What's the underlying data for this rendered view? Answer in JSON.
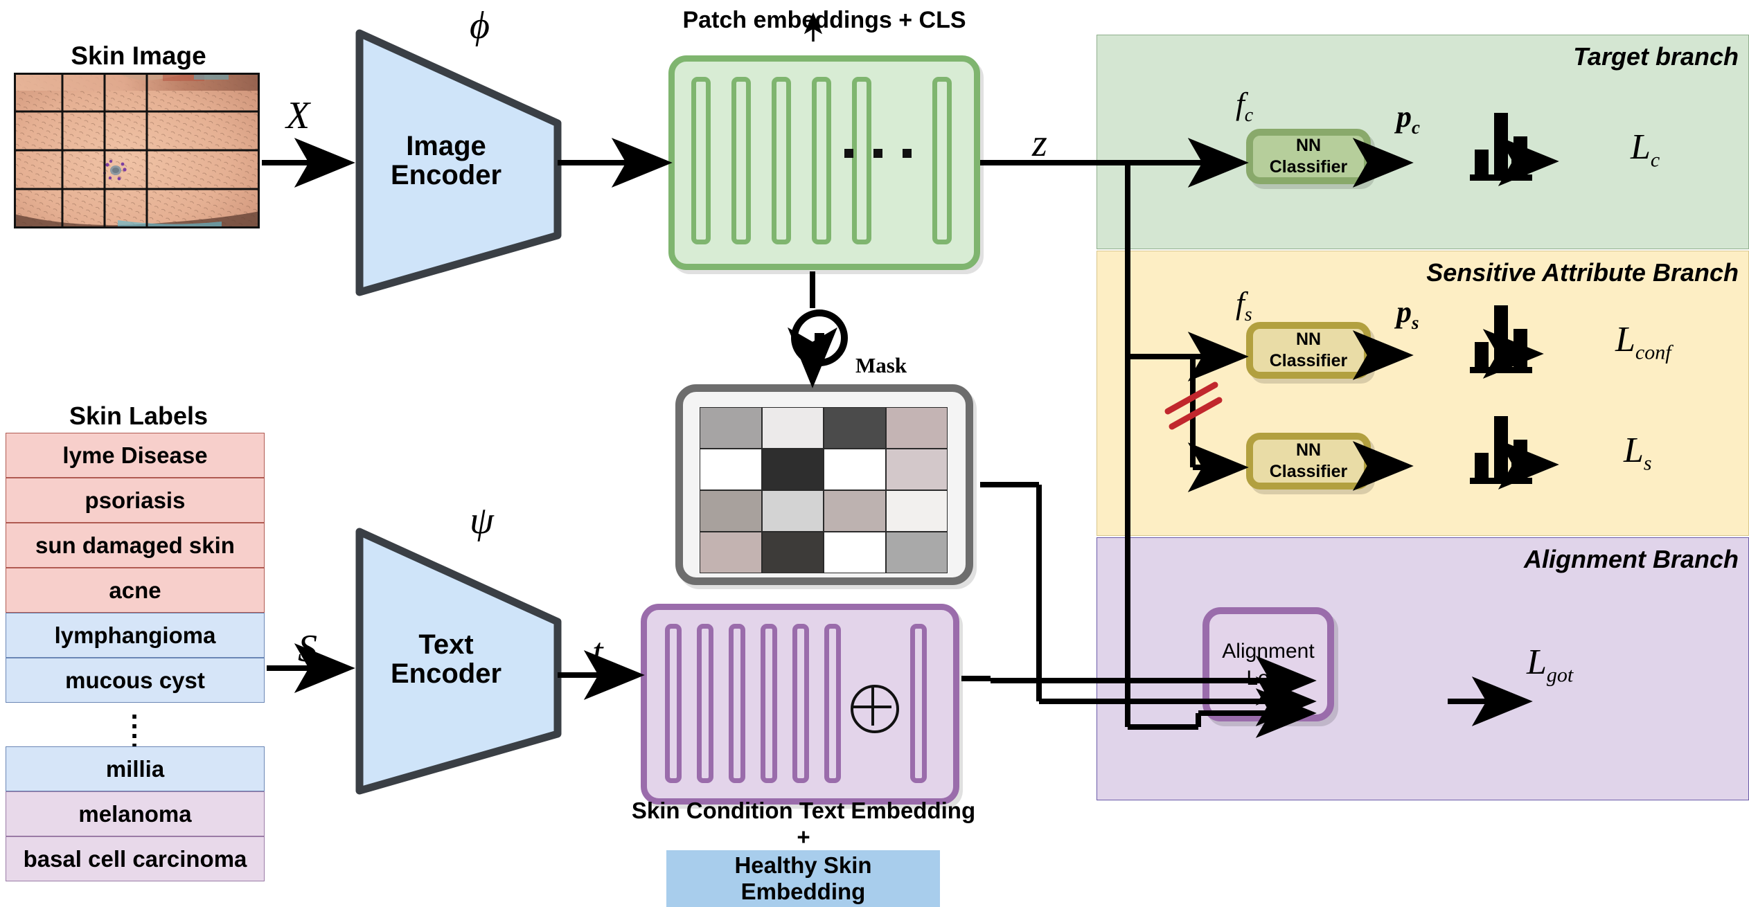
{
  "image_panel": {
    "title": "Skin Image",
    "grid": "4x4",
    "input_symbol": "X"
  },
  "labels_panel": {
    "title": "Skin Labels",
    "items": [
      {
        "text": "lyme Disease",
        "group": "pink"
      },
      {
        "text": "psoriasis",
        "group": "pink"
      },
      {
        "text": "sun damaged skin",
        "group": "pink"
      },
      {
        "text": "acne",
        "group": "pink"
      },
      {
        "text": "lymphangioma",
        "group": "blue"
      },
      {
        "text": "mucous cyst",
        "group": "blue"
      },
      {
        "text": "millia",
        "group": "blue"
      },
      {
        "text": "melanoma",
        "group": "purple"
      },
      {
        "text": "basal cell carcinoma",
        "group": "purple"
      }
    ],
    "ellipsis": "vertical-dots",
    "input_symbol": "S"
  },
  "encoders": {
    "image": {
      "line1": "Image",
      "line2": "Encoder",
      "param": "ϕ",
      "input": "X"
    },
    "text": {
      "line1": "Text",
      "line2": "Encoder",
      "param": "ψ",
      "input": "S",
      "output": "t"
    }
  },
  "patch_embeddings": {
    "title": "Patch embeddings + CLS",
    "bar_count": 6,
    "ellipsis": "...",
    "output_symbol": "z"
  },
  "mask": {
    "title": "Mask",
    "operator": "⊙",
    "rows": 4,
    "cols": 4,
    "cells": [
      [
        "#a6a4a4",
        "#eceaea",
        "#4b4b4b",
        "#c4b4b4"
      ],
      [
        "#ffffff",
        "#2e2e2e",
        "#ffffff",
        "#d3c8ca"
      ],
      [
        "#a8a19d",
        "#d3d3d3",
        "#bdb2b0",
        "#f2f0ee"
      ],
      [
        "#c3b3b1",
        "#3d3b39",
        "#ffffff",
        "#a9a9a9"
      ]
    ]
  },
  "text_embedding": {
    "bar_count": 7,
    "operator": "⊕",
    "caption_line1": "Skin Condition Text Embedding",
    "caption_plus": "+",
    "caption_line2": "Healthy Skin Embedding",
    "highlight_color": "#a8cdec"
  },
  "branches": [
    {
      "id": "target",
      "title": "Target branch",
      "bg": "#d4e6d2",
      "fn_symbol": "f_c",
      "classifier": {
        "line1": "NN",
        "line2": "Classifier",
        "fill": "#b6ce9b",
        "stroke": "#89a96b"
      },
      "prob_symbol": "p_c",
      "histogram": [
        0.4,
        1.0,
        0.62
      ],
      "loss_symbol": "L_c"
    },
    {
      "id": "sensitive",
      "title": "Sensitive Attribute Branch",
      "bg": "#fdeec4",
      "fn_symbol": "f_s",
      "gradient_block": "red-double-slash",
      "rows": [
        {
          "classifier": {
            "line1": "NN",
            "line2": "Classifier",
            "fill": "#e9dca6",
            "stroke": "#b2a03f"
          },
          "prob_symbol": "p_s",
          "histogram": [
            0.4,
            1.0,
            0.62
          ],
          "loss_symbol": "L_conf"
        },
        {
          "classifier": {
            "line1": "NN",
            "line2": "Classifier",
            "fill": "#e9dca6",
            "stroke": "#b2a03f"
          },
          "prob_symbol": "",
          "histogram": [
            0.4,
            1.0,
            0.62
          ],
          "loss_symbol": "L_s"
        }
      ]
    },
    {
      "id": "alignment",
      "title": "Alignment Branch",
      "bg": "#e0d4ea",
      "box": {
        "line1": "Alignment",
        "line2": "Loss",
        "fill": "#e3d4ea",
        "stroke": "#9a6cab"
      },
      "input_arrows": 3,
      "loss_symbol": "L_got"
    }
  ],
  "math": {
    "X": "X",
    "S": "S",
    "t": "t",
    "z": "z",
    "phi": "ϕ",
    "psi": "ψ",
    "f_c_base": "f",
    "f_c_sub": "c",
    "f_s_base": "f",
    "f_s_sub": "s",
    "p_c_base": "p",
    "p_c_sub": "c",
    "p_s_base": "p",
    "p_s_sub": "s",
    "L_base": "L",
    "L_c_sub": "c",
    "L_conf_sub": "conf",
    "L_s_sub": "s",
    "L_got_sub": "got"
  }
}
